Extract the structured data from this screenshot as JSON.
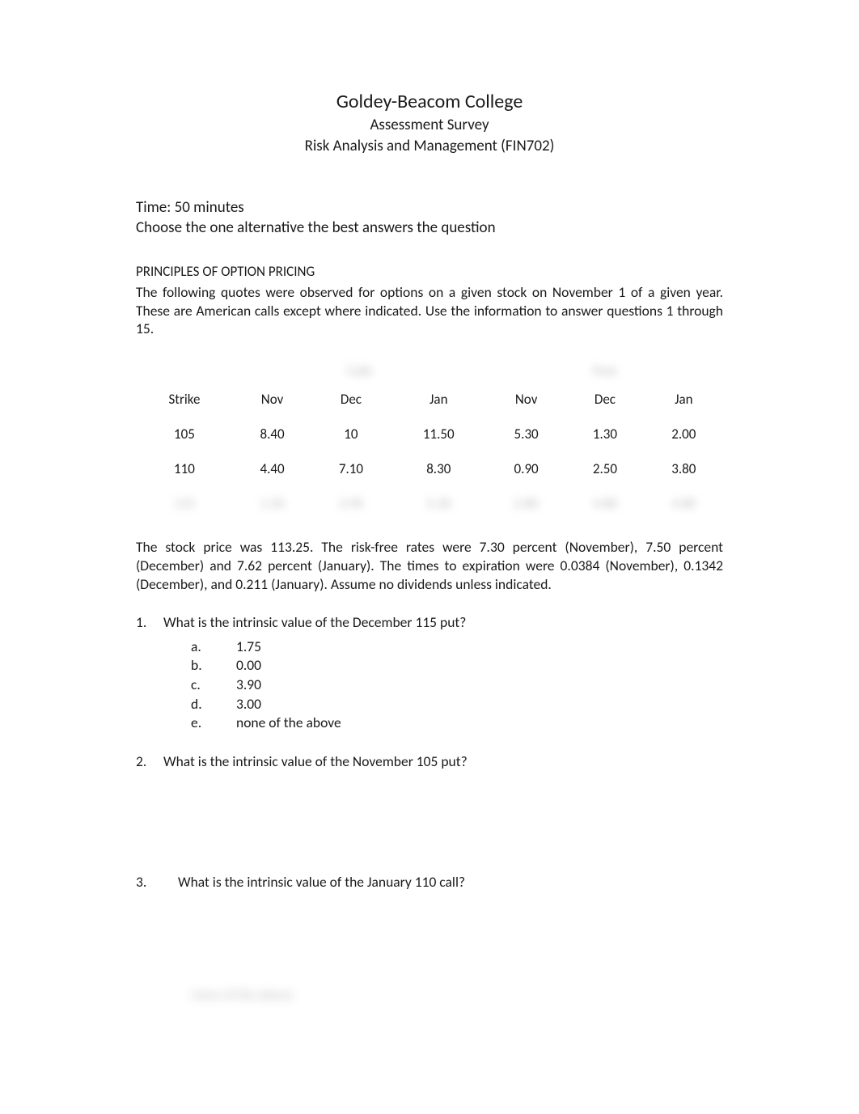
{
  "header": {
    "title": "Goldey-Beacom College",
    "subtitle": "Assessment Survey",
    "course": "Risk Analysis and Management (FIN702)"
  },
  "instructions": {
    "time": "Time: 50 minutes",
    "choose": "Choose the one alternative the best answers the question"
  },
  "section": {
    "heading": "PRINCIPLES OF OPTION PRICING",
    "intro": "The following quotes were observed for options on a given stock on November 1 of a given year. These are American calls except where indicated. Use the information to answer questions 1 through 15."
  },
  "table": {
    "groupHeaders": {
      "calls": "Calls",
      "puts": "Puts"
    },
    "cols": {
      "strike": "Strike",
      "nov": "Nov",
      "dec": "Dec",
      "jan": "Jan",
      "nov2": "Nov",
      "dec2": "Dec",
      "jan2": "Jan"
    },
    "rows": [
      {
        "strike": "105",
        "cNov": "8.40",
        "cDec": "10",
        "cJan": "11.50",
        "pNov": "5.30",
        "pDec": "1.30",
        "pJan": "2.00"
      },
      {
        "strike": "110",
        "cNov": "4.40",
        "cDec": "7.10",
        "cJan": "8.30",
        "pNov": "0.90",
        "pDec": "2.50",
        "pJan": "3.80"
      },
      {
        "strike": "115",
        "cNov": "1.50",
        "cDec": "3.90",
        "cJan": "5.30",
        "pNov": "2.80",
        "pDec": "4.80",
        "pJan": "4.80"
      }
    ]
  },
  "stockText": "The stock price was 113.25. The risk-free rates were 7.30 percent (November), 7.50 percent (December) and 7.62 percent (January). The times to expiration were 0.0384 (November), 0.1342 (December), and 0.211 (January). Assume no dividends unless indicated.",
  "questions": {
    "q1": {
      "num": "1.",
      "text": "What is the intrinsic value of the December 115 put?",
      "opts": {
        "a": {
          "label": "a.",
          "val": "1.75"
        },
        "b": {
          "label": "b.",
          "val": "0.00"
        },
        "c": {
          "label": "c.",
          "val": "3.90"
        },
        "d": {
          "label": "d.",
          "val": "3.00"
        },
        "e": {
          "label": "e.",
          "val": "none of the above"
        }
      }
    },
    "q2": {
      "num": "2.",
      "text": "What is the intrinsic value of the November 105 put?"
    },
    "q3": {
      "num": "3.",
      "text": "What is the intrinsic value of the January 110 call?"
    }
  },
  "blurBottom": "none of the above"
}
